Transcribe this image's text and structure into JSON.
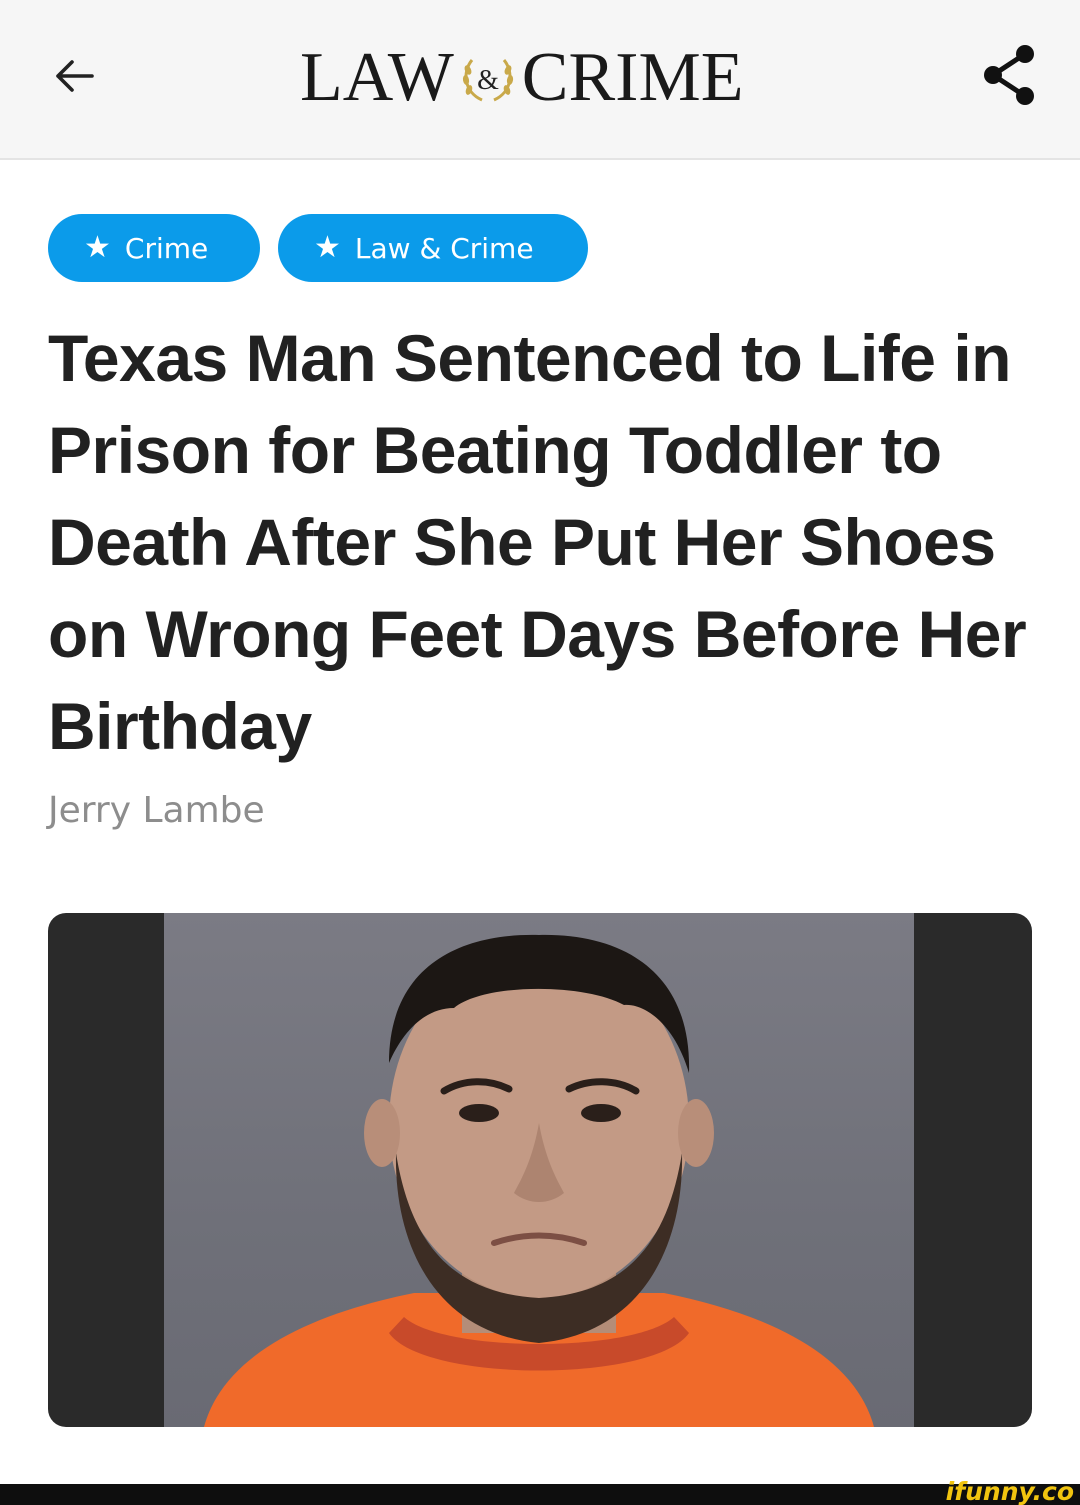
{
  "header": {
    "back_icon": "arrow-left-icon",
    "logo_left": "LAW",
    "logo_amp": "&",
    "logo_right": "CRIME",
    "share_icon": "share-icon"
  },
  "tags": [
    {
      "icon": "star-icon",
      "label": "Crime"
    },
    {
      "icon": "star-icon",
      "label": "Law & Crime"
    }
  ],
  "article": {
    "headline": "Texas Man Sentenced to Life in Prison for Beating Toddler to Death After She Put Her Shoes on Wrong Feet Days Before Her Birthday",
    "author": "Jerry Lambe"
  },
  "watermark": "ifunny.co",
  "colors": {
    "accent": "#0b9bea",
    "text": "#212121",
    "muted": "#8d8d8d",
    "topbar": "#f6f6f6",
    "jumpsuit": "#f06a2a"
  }
}
